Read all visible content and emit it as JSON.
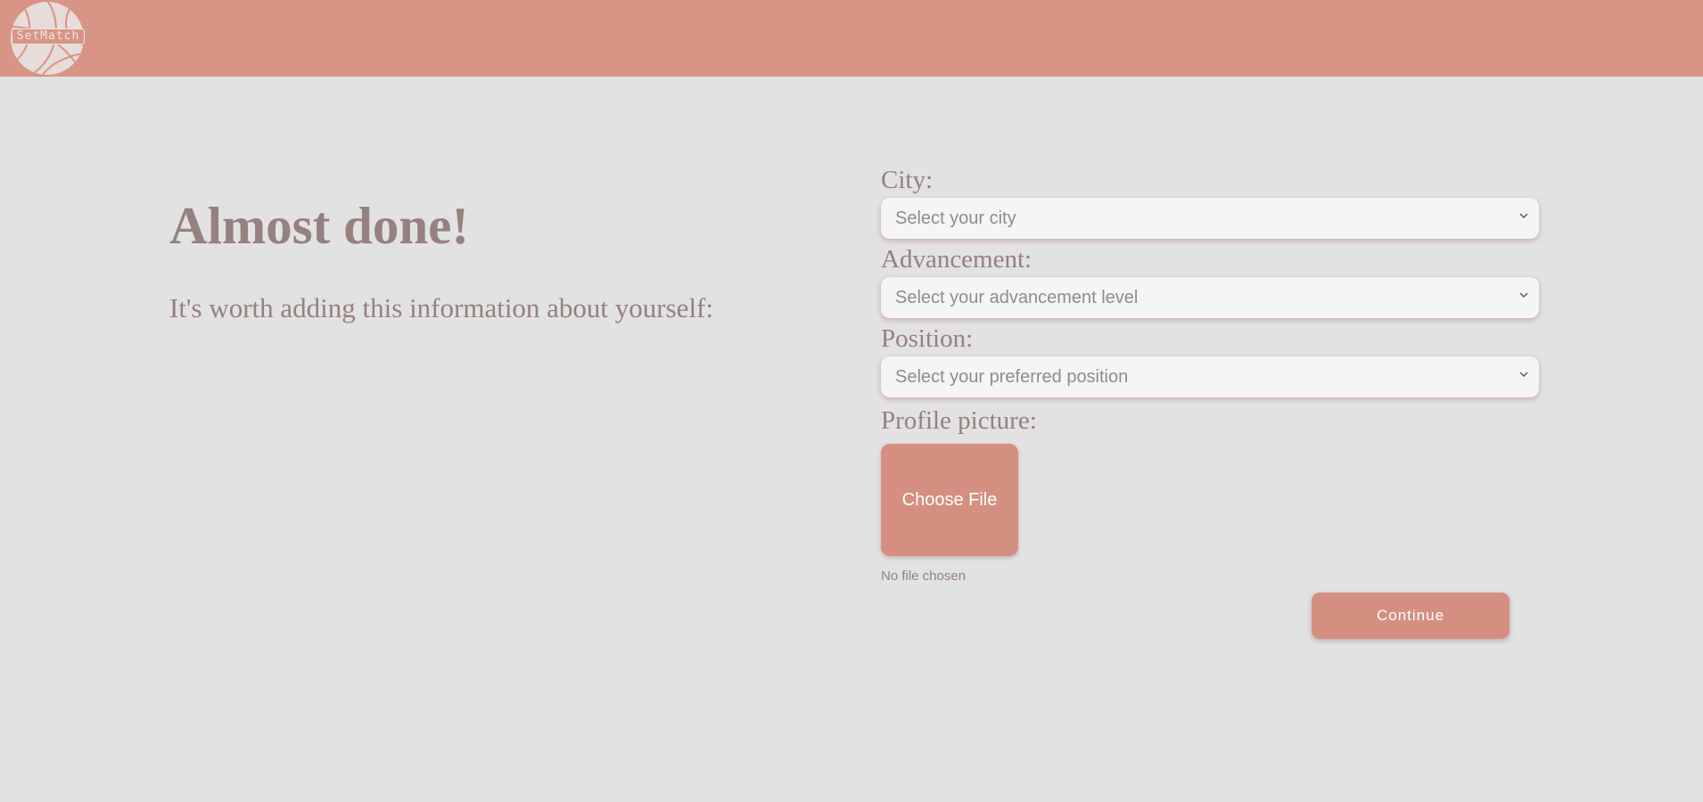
{
  "header": {
    "logo_text": "SetMatch",
    "background_color": "#d89484"
  },
  "intro": {
    "title": "Almost done!",
    "subtitle": "It's worth adding this information about yourself:"
  },
  "form": {
    "city": {
      "label": "City:",
      "selected": "Select your city"
    },
    "advancement": {
      "label": "Advancement:",
      "selected": "Select your advancement level"
    },
    "position": {
      "label": "Position:",
      "selected": "Select your preferred position"
    },
    "profile_picture": {
      "label": "Profile picture:",
      "button_label": "Choose File",
      "status": "No file chosen"
    },
    "continue_label": "Continue"
  },
  "colors": {
    "accent": "#d58f81",
    "text": "#968080",
    "page_background": "#e2e2e2"
  }
}
